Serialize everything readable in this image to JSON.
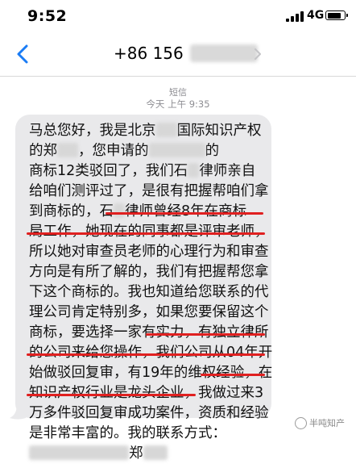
{
  "status_bar": {
    "time": "9:52",
    "network": "4G"
  },
  "header": {
    "contact_number": "+86 156"
  },
  "thread": {
    "label": "短信",
    "timestamp": "今天 上午 9:35"
  },
  "message": {
    "lines": [
      "马总您好，我是北京",
      "国际知识产权",
      "的郑",
      "，您申请的",
      "的",
      "商标12类驳回了，我们石",
      "律师亲自",
      "给咱们测评过了，是很有把握帮咱们拿",
      "到商标的，石",
      "律师曾经8年在商标",
      "局工作，她现在的同事都是评审老师，",
      "所以她对审查员老师的心理行为和审查",
      "方向是有所了解的，我们有把握帮您拿",
      "下这个商标的。我也知道给您联系的代",
      "理公司肯定特别多，如果您要保留这个",
      "商标，要选择一家有实力，有独立律所",
      "的公司来给您操作，我们公司从04年开",
      "始做驳回复审，有19年的维权经验，在",
      "知识产权行业是龙头企业，我做过来3",
      "万多件驳回复审成功案件，资质和经验",
      "是非常丰富的。我的联系方式：",
      "郑"
    ]
  },
  "watermark": {
    "text": "半吨知产"
  },
  "colors": {
    "bubble": "#e9e9eb",
    "accent": "#1a7cf5",
    "underline": "#e02020",
    "meta": "#8e8e93"
  }
}
